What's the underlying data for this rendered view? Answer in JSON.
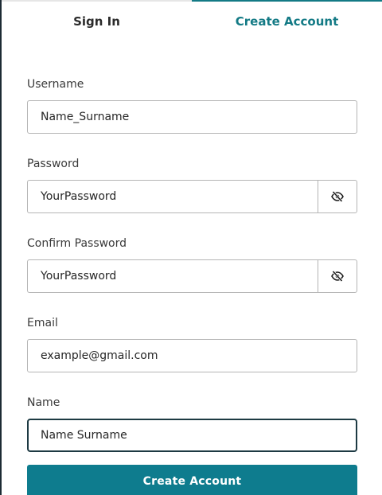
{
  "tabs": {
    "sign_in": "Sign In",
    "create_account": "Create Account",
    "active": "create_account"
  },
  "form": {
    "username": {
      "label": "Username",
      "value": "Name_Surname"
    },
    "password": {
      "label": "Password",
      "value": "YourPassword",
      "toggle_icon": "eye-slash-icon"
    },
    "confirm_password": {
      "label": "Confirm Password",
      "value": "YourPassword",
      "toggle_icon": "eye-slash-icon"
    },
    "email": {
      "label": "Email",
      "value": "example@gmail.com"
    },
    "name": {
      "label": "Name",
      "value": "Name Surname",
      "focused": true
    }
  },
  "submit_label": "Create Account",
  "colors": {
    "accent": "#0e7c8e",
    "active_tab_text": "#137a85",
    "focus_border": "#1d3a43"
  }
}
